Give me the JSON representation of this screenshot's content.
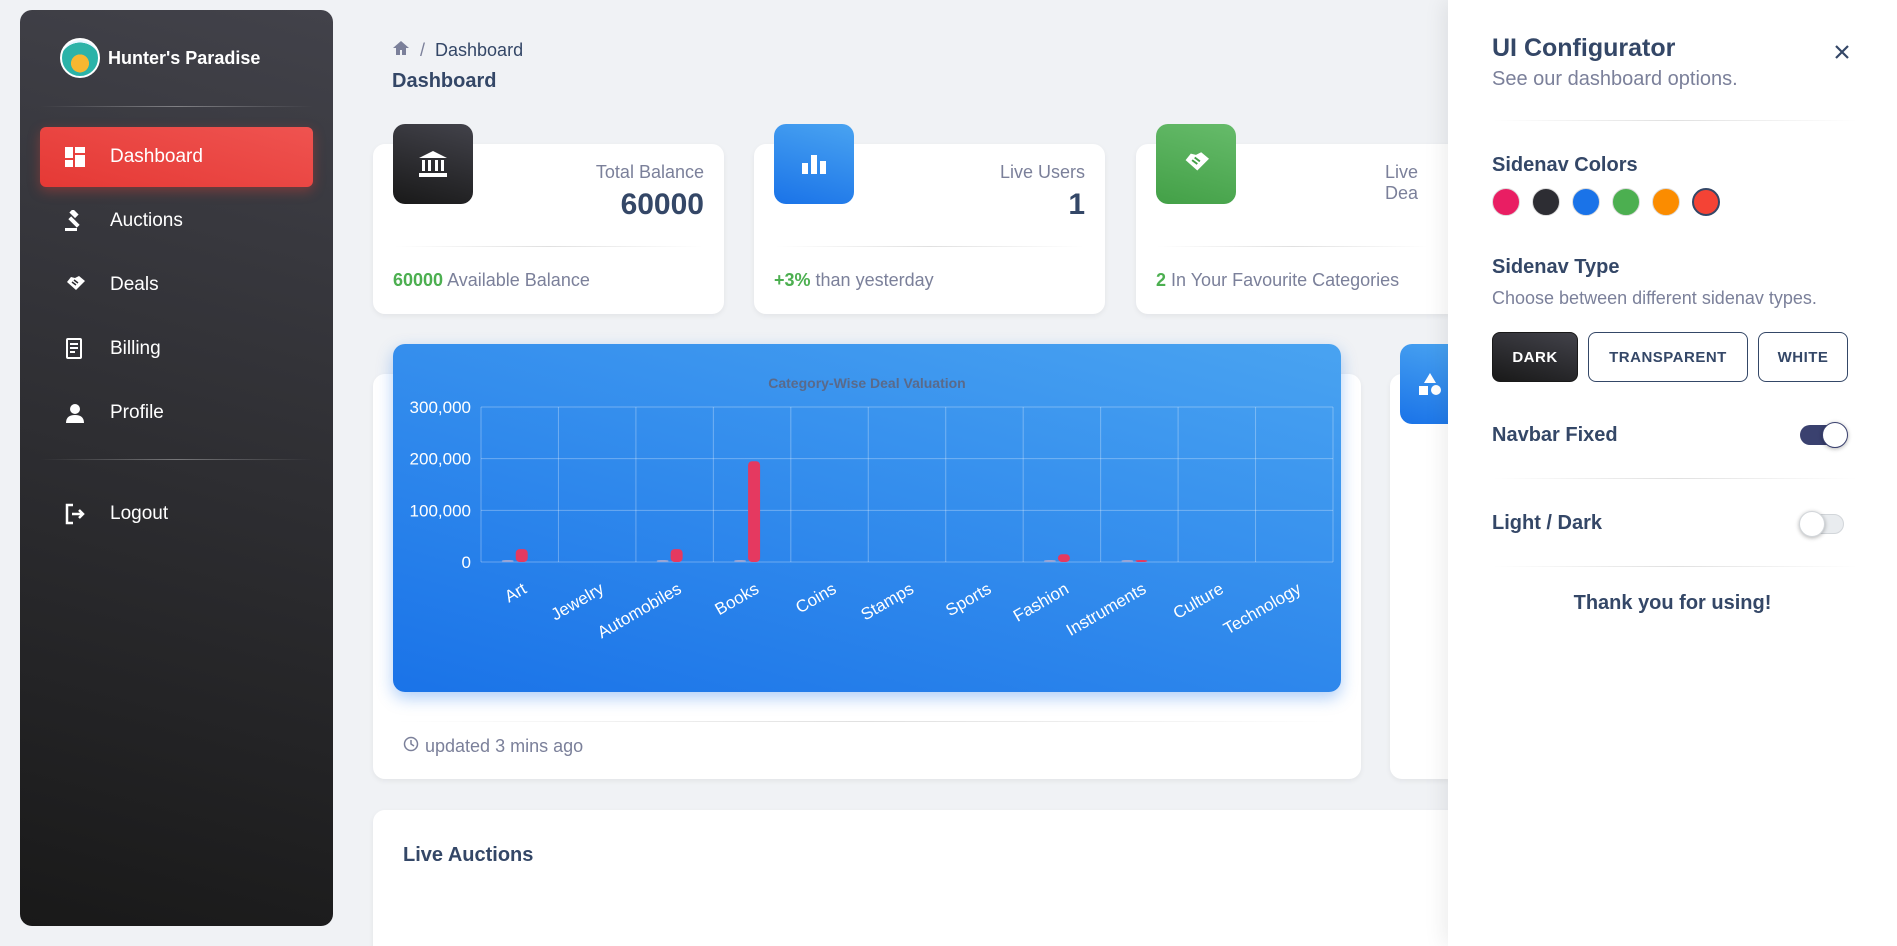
{
  "sidebar": {
    "brand": "Hunter's Paradise",
    "items": [
      {
        "label": "Dashboard",
        "icon": "dashboard-icon",
        "active": true
      },
      {
        "label": "Auctions",
        "icon": "gavel-icon"
      },
      {
        "label": "Deals",
        "icon": "handshake-icon"
      },
      {
        "label": "Billing",
        "icon": "receipt-icon"
      },
      {
        "label": "Profile",
        "icon": "person-icon"
      }
    ],
    "logout": "Logout"
  },
  "breadcrumb": {
    "current": "Dashboard"
  },
  "page_title": "Dashboard",
  "stats": [
    {
      "label": "Total Balance",
      "value": "60000",
      "foot_strong": "60000",
      "foot_text": " Available Balance",
      "icon": "bank-icon",
      "color": "#1f1f24"
    },
    {
      "label": "Live Users",
      "value": "1",
      "foot_strong": "+3%",
      "foot_text": " than yesterday",
      "icon": "bar-chart-icon",
      "color": "#1a73e8"
    },
    {
      "label": "Live Dea",
      "value": "",
      "foot_strong": "2",
      "foot_text": " In Your Favourite Categories",
      "icon": "handshake-icon",
      "color": "#43a047"
    }
  ],
  "chart_footer": "updated 3 mins ago",
  "live_auctions": {
    "title": "Live Auctions"
  },
  "chart_data": {
    "type": "bar",
    "title": "Category-Wise Deal Valuation",
    "categories": [
      "Art",
      "Jewelry",
      "Automobiles",
      "Books",
      "Coins",
      "Stamps",
      "Sports",
      "Fashion",
      "Instruments",
      "Culture",
      "Technology"
    ],
    "series": [
      {
        "values": [
          2000,
          0,
          1500,
          1000,
          0,
          0,
          0,
          1000,
          1000,
          0,
          0
        ],
        "color": "#9aa6d6"
      },
      {
        "values": [
          25000,
          0,
          25000,
          195000,
          0,
          0,
          0,
          15000,
          2000,
          0,
          0
        ],
        "color": "#e53960"
      }
    ],
    "yticks": [
      "300,000",
      "200,000",
      "100,000",
      "0"
    ],
    "ylim": [
      0,
      300000
    ],
    "grid": true
  },
  "configurator": {
    "title": "UI Configurator",
    "subtitle": "See our dashboard options.",
    "sidenav_colors_title": "Sidenav Colors",
    "swatches": [
      "#e91e63",
      "#2d2d33",
      "#1a73e8",
      "#4caf50",
      "#fb8c00",
      "#f44335"
    ],
    "sidenav_type_title": "Sidenav Type",
    "sidenav_type_desc": "Choose between different sidenav types.",
    "types": [
      "DARK",
      "TRANSPARENT",
      "WHITE"
    ],
    "navbar_fixed": "Navbar Fixed",
    "navbar_fixed_on": true,
    "light_dark": "Light / Dark",
    "light_dark_on": false,
    "thanks": "Thank you for using!"
  }
}
